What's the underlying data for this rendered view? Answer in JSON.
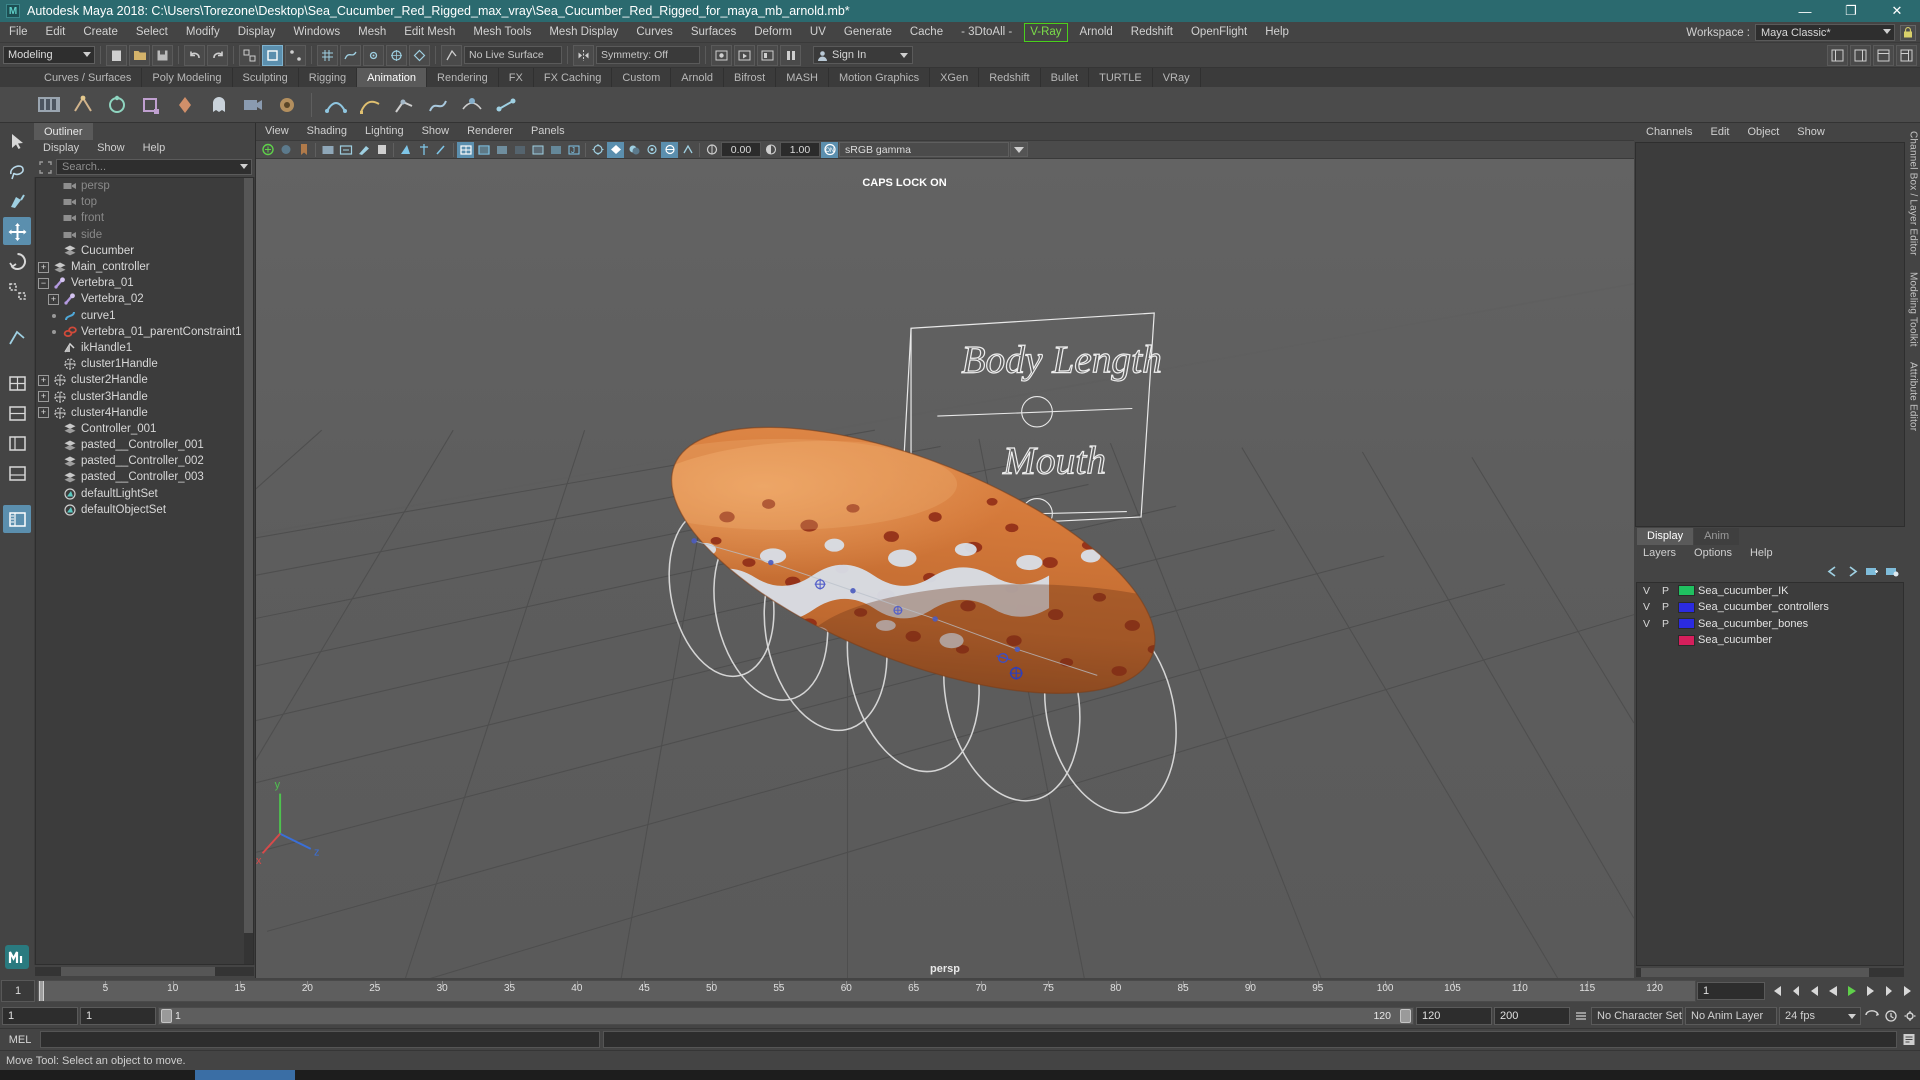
{
  "window": {
    "title": "Autodesk Maya 2018: C:\\Users\\Torezone\\Desktop\\Sea_Cucumber_Red_Rigged_max_vray\\Sea_Cucumber_Red_Rigged_for_maya_mb_arnold.mb*",
    "logo": "M",
    "minimize": "—",
    "maximize": "❐",
    "close": "✕"
  },
  "menubar": {
    "items": [
      "File",
      "Edit",
      "Create",
      "Select",
      "Modify",
      "Display",
      "Windows",
      "Mesh",
      "Edit Mesh",
      "Mesh Tools",
      "Mesh Display",
      "Curves",
      "Surfaces",
      "Deform",
      "UV",
      "Generate",
      "Cache",
      "- 3DtoAll -"
    ],
    "vray": "V-Ray",
    "items_after": [
      "Arnold",
      "Redshift",
      "OpenFlight",
      "Help"
    ],
    "workspace_label": "Workspace :",
    "workspace_value": "Maya Classic*",
    "lock_icon": "lock-icon"
  },
  "statusline": {
    "mode": "Modeling",
    "live_surface": "No Live Surface",
    "symmetry": "Symmetry: Off",
    "sign_in": "Sign In",
    "snap_active": "snap-to-grid"
  },
  "shelf": {
    "tabs": [
      "Curves / Surfaces",
      "Poly Modeling",
      "Sculpting",
      "Rigging",
      "Animation",
      "Rendering",
      "FX",
      "FX Caching",
      "Custom",
      "Arnold",
      "Bifrost",
      "MASH",
      "Motion Graphics",
      "XGen",
      "Redshift",
      "Bullet",
      "TURTLE",
      "VRay"
    ],
    "active_tab": "Animation"
  },
  "outliner": {
    "tab": "Outliner",
    "menus": [
      "Display",
      "Show",
      "Help"
    ],
    "search_placeholder": "Search...",
    "items": [
      {
        "label": "persp",
        "icon": "camera-icon",
        "indent": 1,
        "expander": "",
        "dim": true
      },
      {
        "label": "top",
        "icon": "camera-icon",
        "indent": 1,
        "expander": "",
        "dim": true
      },
      {
        "label": "front",
        "icon": "camera-icon",
        "indent": 1,
        "expander": "",
        "dim": true
      },
      {
        "label": "side",
        "icon": "camera-icon",
        "indent": 1,
        "expander": "",
        "dim": true
      },
      {
        "label": "Cucumber",
        "icon": "transform-icon",
        "indent": 1,
        "expander": "",
        "dim": false
      },
      {
        "label": "Main_controller",
        "icon": "transform-icon",
        "indent": 0,
        "expander": "+",
        "dim": false
      },
      {
        "label": "Vertebra_01",
        "icon": "joint-icon",
        "indent": 0,
        "expander": "-",
        "dim": false
      },
      {
        "label": "Vertebra_02",
        "icon": "joint-icon",
        "indent": 1,
        "expander": "+",
        "dim": false
      },
      {
        "label": "curve1",
        "icon": "curve-icon",
        "indent": 1,
        "expander": "dot",
        "dim": false
      },
      {
        "label": "Vertebra_01_parentConstraint1",
        "icon": "constraint-icon",
        "indent": 1,
        "expander": "dot",
        "dim": false
      },
      {
        "label": "ikHandle1",
        "icon": "ikhandle-icon",
        "indent": 1,
        "expander": "",
        "dim": false
      },
      {
        "label": "cluster1Handle",
        "icon": "cluster-icon",
        "indent": 1,
        "expander": "",
        "dim": false
      },
      {
        "label": "cluster2Handle",
        "icon": "cluster-icon",
        "indent": 0,
        "expander": "+",
        "dim": false
      },
      {
        "label": "cluster3Handle",
        "icon": "cluster-icon",
        "indent": 0,
        "expander": "+",
        "dim": false
      },
      {
        "label": "cluster4Handle",
        "icon": "cluster-icon",
        "indent": 0,
        "expander": "+",
        "dim": false
      },
      {
        "label": "Controller_001",
        "icon": "transform-icon",
        "indent": 1,
        "expander": "",
        "dim": false
      },
      {
        "label": "pasted__Controller_001",
        "icon": "transform-icon",
        "indent": 1,
        "expander": "",
        "dim": false
      },
      {
        "label": "pasted__Controller_002",
        "icon": "transform-icon",
        "indent": 1,
        "expander": "",
        "dim": false
      },
      {
        "label": "pasted__Controller_003",
        "icon": "transform-icon",
        "indent": 1,
        "expander": "",
        "dim": false
      },
      {
        "label": "defaultLightSet",
        "icon": "set-icon",
        "indent": 1,
        "expander": "",
        "dim": false
      },
      {
        "label": "defaultObjectSet",
        "icon": "set-icon",
        "indent": 1,
        "expander": "",
        "dim": false
      }
    ]
  },
  "viewport": {
    "menus": [
      "View",
      "Shading",
      "Lighting",
      "Show",
      "Renderer",
      "Panels"
    ],
    "exposure": "0.00",
    "gamma_value": "1.00",
    "color_profile": "sRGB gamma",
    "caps_lock": "CAPS LOCK ON",
    "camera_label": "persp",
    "annotation_body_length": "Body Length",
    "annotation_mouth": "Mouth",
    "axis_labels": {
      "x": "x",
      "y": "y",
      "z": "z"
    }
  },
  "channelbox": {
    "tabs": [
      "Channels",
      "Edit",
      "Object",
      "Show"
    ],
    "side_labels": [
      "Channel Box / Layer Editor",
      "Modeling Toolkit",
      "Attribute Editor"
    ]
  },
  "layers": {
    "tabs": [
      "Display",
      "Anim"
    ],
    "active_tab": "Display",
    "menus": [
      "Layers",
      "Options",
      "Help"
    ],
    "columns": [
      "V",
      "P"
    ],
    "rows": [
      {
        "v": "V",
        "p": "P",
        "color": "#20c060",
        "name": "Sea_cucumber_IK"
      },
      {
        "v": "V",
        "p": "P",
        "color": "#2b2be0",
        "name": "Sea_cucumber_controllers"
      },
      {
        "v": "V",
        "p": "P",
        "color": "#2b2be0",
        "name": "Sea_cucumber_bones"
      },
      {
        "v": "",
        "p": "",
        "color": "#d61f5c",
        "name": "Sea_cucumber"
      }
    ]
  },
  "timeline": {
    "current_frame_left": "1",
    "ticks": [
      "5",
      "10",
      "15",
      "20",
      "25",
      "30",
      "35",
      "40",
      "45",
      "50",
      "55",
      "60",
      "65",
      "70",
      "75",
      "80",
      "85",
      "90",
      "95",
      "100",
      "105",
      "110",
      "115",
      "120"
    ],
    "frame_field": "1",
    "range_start": "1",
    "range_start2": "1",
    "range_bar_start": "1",
    "range_bar_end": "120",
    "anim_end": "120",
    "playback_end": "200",
    "character_set": "No Character Set",
    "anim_layer": "No Anim Layer",
    "fps": "24 fps"
  },
  "commandline": {
    "mel_label": "MEL",
    "input_value": "",
    "output_value": ""
  },
  "helpline": {
    "text": "Move Tool: Select an object to move."
  },
  "colors": {
    "title_bar": "#2b6a6f",
    "panel_bg": "#444444",
    "viewport_bg": "#5d5d5d",
    "accent_blue": "#5b8fae",
    "vray_green": "#7bdd4a"
  }
}
